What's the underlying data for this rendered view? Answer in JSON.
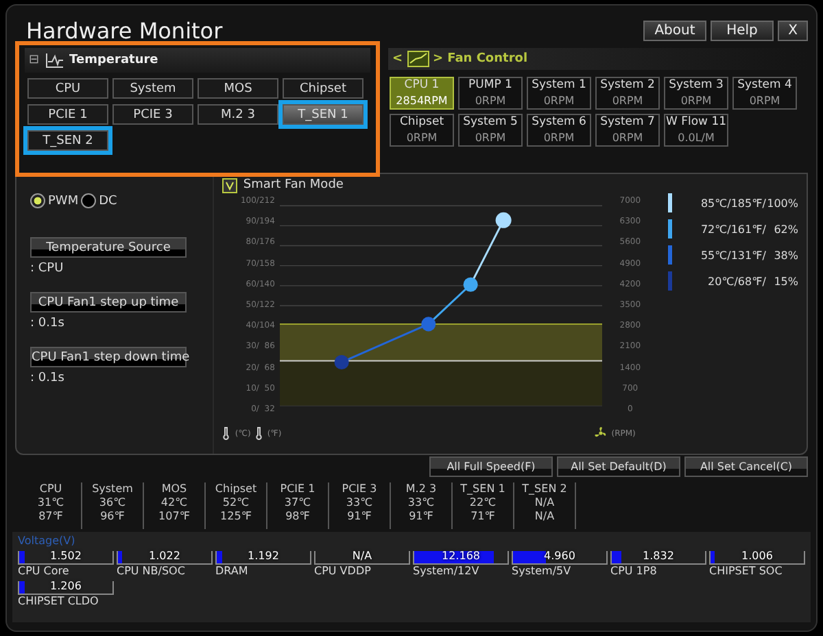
{
  "window": {
    "title": "Hardware Monitor",
    "buttons": [
      "About",
      "Help",
      "X"
    ]
  },
  "temperature_panel": {
    "title": "Temperature",
    "expand_symbol": "⊟",
    "highlighted": true,
    "sensors": [
      {
        "label": "CPU",
        "selected": false,
        "highlighted": false
      },
      {
        "label": "System",
        "selected": false,
        "highlighted": false
      },
      {
        "label": "MOS",
        "selected": false,
        "highlighted": false
      },
      {
        "label": "Chipset",
        "selected": false,
        "highlighted": false
      },
      {
        "label": "PCIE 1",
        "selected": false,
        "highlighted": false
      },
      {
        "label": "PCIE 3",
        "selected": false,
        "highlighted": false
      },
      {
        "label": "M.2 3",
        "selected": false,
        "highlighted": false
      },
      {
        "label": "T_SEN 1",
        "selected": true,
        "highlighted": true
      },
      {
        "label": "T_SEN 2",
        "selected": false,
        "highlighted": true
      }
    ]
  },
  "fan_control": {
    "title": "Fan Control",
    "prev": "<",
    "next": ">",
    "fans": [
      {
        "name": "CPU 1",
        "reading": "2854RPM",
        "selected": true
      },
      {
        "name": "PUMP 1",
        "reading": "0RPM",
        "selected": false
      },
      {
        "name": "System 1",
        "reading": "0RPM",
        "selected": false
      },
      {
        "name": "System 2",
        "reading": "0RPM",
        "selected": false
      },
      {
        "name": "System 3",
        "reading": "0RPM",
        "selected": false
      },
      {
        "name": "System 4",
        "reading": "0RPM",
        "selected": false
      },
      {
        "name": "Chipset",
        "reading": "0RPM",
        "selected": false
      },
      {
        "name": "System 5",
        "reading": "0RPM",
        "selected": false
      },
      {
        "name": "System 6",
        "reading": "0RPM",
        "selected": false
      },
      {
        "name": "System 7",
        "reading": "0RPM",
        "selected": false
      },
      {
        "name": "W Flow 11",
        "reading": "0.0L/M",
        "selected": false
      }
    ]
  },
  "fan_settings": {
    "modes": [
      {
        "label": "PWM",
        "selected": true
      },
      {
        "label": "DC",
        "selected": false
      }
    ],
    "settings": [
      {
        "label": "Temperature Source",
        "value": ": CPU"
      },
      {
        "label": "CPU Fan1 step up time",
        "value": ": 0.1s"
      },
      {
        "label": "CPU Fan1 step down time",
        "value": ": 0.1s"
      }
    ]
  },
  "fan_curve": {
    "smart_fan_mode": {
      "label": "Smart Fan Mode",
      "checked": true
    },
    "temp_axis_labels": [
      "100/212",
      "90/194",
      "80/176",
      "70/158",
      "60/140",
      "50/122",
      "40/104",
      "30/  86",
      "20/  68",
      "10/  50",
      "0/  32"
    ],
    "rpm_axis_labels": [
      "7000",
      "6300",
      "5600",
      "4900",
      "4200",
      "3500",
      "2800",
      "2100",
      "1400",
      "700",
      "0"
    ],
    "temp_units": [
      "(℃)",
      "(℉)"
    ],
    "rpm_unit": "(RPM)",
    "legend": [
      {
        "temperature": "85℃/185℉/",
        "percent": "100%",
        "color": "#a8dcff"
      },
      {
        "temperature": "72℃/161℉/",
        "percent": "62%",
        "color": "#3fa6f0"
      },
      {
        "temperature": "55℃/131℉/",
        "percent": "38%",
        "color": "#2366d8"
      },
      {
        "temperature": "20℃/68℉/",
        "percent": "15%",
        "color": "#1a3a9a"
      }
    ]
  },
  "actions": [
    "All Full Speed(F)",
    "All Set Default(D)",
    "All Set Cancel(C)"
  ],
  "temperatures": [
    {
      "name": "CPU",
      "celsius": "31℃",
      "fahrenheit": "87℉"
    },
    {
      "name": "System",
      "celsius": "36℃",
      "fahrenheit": "96℉"
    },
    {
      "name": "MOS",
      "celsius": "42℃",
      "fahrenheit": "107℉"
    },
    {
      "name": "Chipset",
      "celsius": "52℃",
      "fahrenheit": "125℉"
    },
    {
      "name": "PCIE 1",
      "celsius": "37℃",
      "fahrenheit": "98℉"
    },
    {
      "name": "PCIE 3",
      "celsius": "33℃",
      "fahrenheit": "91℉"
    },
    {
      "name": "M.2 3",
      "celsius": "33℃",
      "fahrenheit": "91℉"
    },
    {
      "name": "T_SEN 1",
      "celsius": "22℃",
      "fahrenheit": "71℉"
    },
    {
      "name": "T_SEN 2",
      "celsius": "N/A",
      "fahrenheit": "N/A"
    }
  ],
  "voltage": {
    "title": "Voltage(V)",
    "rails": [
      {
        "name": "CPU Core",
        "value": "1.502",
        "level": 0.06
      },
      {
        "name": "CPU NB/SOC",
        "value": "1.022",
        "level": 0.05
      },
      {
        "name": "DRAM",
        "value": "1.192",
        "level": 0.06
      },
      {
        "name": "CPU VDDP",
        "value": "N/A"
      },
      {
        "name": "System/12V",
        "value": "12.168",
        "level": 0.85
      },
      {
        "name": "System/5V",
        "value": "4.960",
        "level": 0.35
      },
      {
        "name": "CPU 1P8",
        "value": "1.832",
        "level": 0.11
      },
      {
        "name": "CHIPSET SOC",
        "value": "1.006",
        "level": 0.05
      },
      {
        "name": "CHIPSET CLDO",
        "value": "1.206",
        "level": 0.06
      }
    ]
  }
}
